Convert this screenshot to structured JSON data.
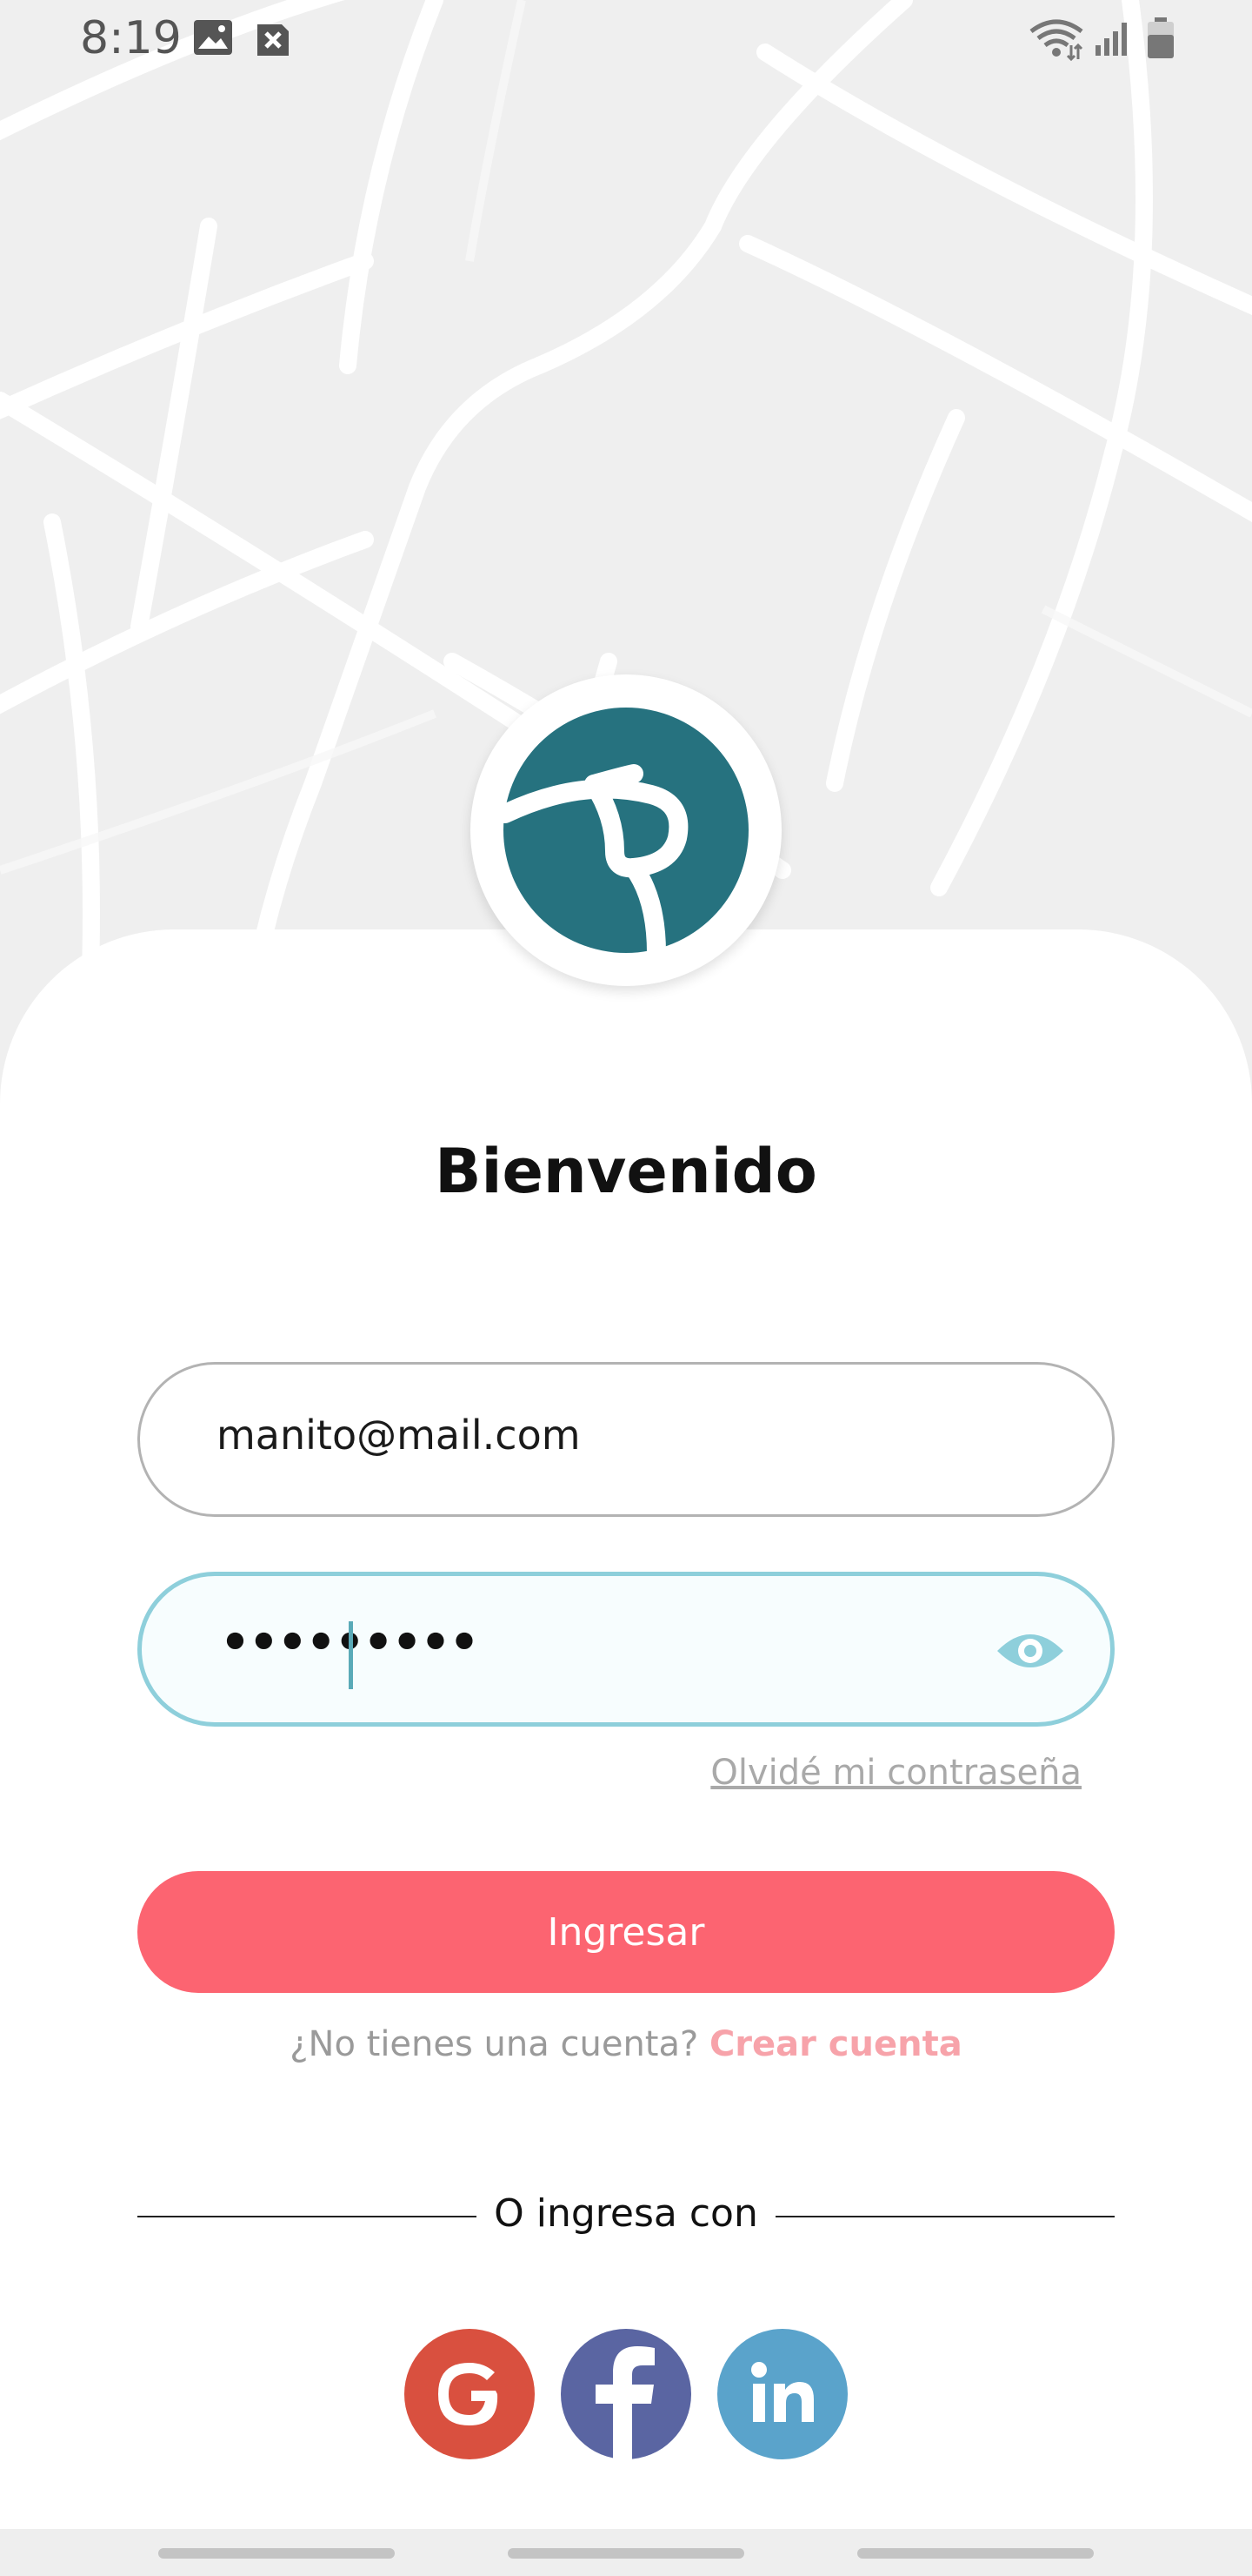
{
  "status_bar": {
    "time": "8:19",
    "icons": [
      "image-icon",
      "close-box-icon",
      "wifi-icon",
      "signal-icon",
      "battery-icon"
    ]
  },
  "logo": {
    "icon": "brand-logo-icon",
    "color": "#26727f"
  },
  "title": "Bienvenido",
  "email": {
    "value": "manito@mail.com"
  },
  "password": {
    "value": "•••••••••",
    "toggle_icon": "eye-icon"
  },
  "forgot_password": "Olvidé mi contraseña",
  "login_button": "Ingresar",
  "signup": {
    "question": "¿No tienes una cuenta?",
    "link": "Crear cuenta"
  },
  "divider_text": "O ingresa con",
  "social": [
    {
      "name": "google-icon",
      "color": "#d9503f"
    },
    {
      "name": "facebook-icon",
      "color": "#5a65a2"
    },
    {
      "name": "linkedin-icon",
      "color": "#5aa3cb"
    }
  ],
  "colors": {
    "accent": "#fc6471",
    "focus": "#8ecfdb",
    "brand": "#26727f"
  }
}
